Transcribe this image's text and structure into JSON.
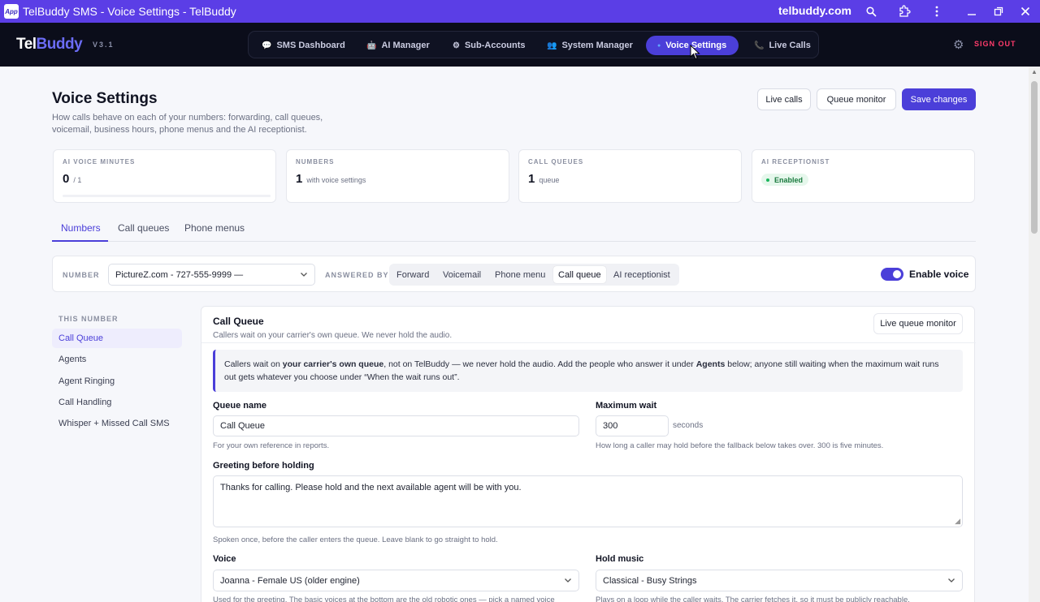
{
  "window": {
    "app_icon": "App",
    "title": "TelBuddy SMS - Voice Settings - TelBuddy",
    "domain": "telbuddy.com",
    "icons": [
      "zoom-icon",
      "extensions-icon",
      "more-icon",
      "minimize-icon",
      "maximize-icon",
      "close-icon"
    ]
  },
  "nav": {
    "brand_tel": "Tel",
    "brand_buddy": "Buddy",
    "version": "V3.1",
    "items": [
      {
        "label": "SMS Dashboard",
        "icon": "💬"
      },
      {
        "label": "AI Manager",
        "icon": "🤖"
      },
      {
        "label": "Sub-Accounts",
        "icon": "⚙"
      },
      {
        "label": "System Manager",
        "icon": "👥"
      },
      {
        "label": "Voice Settings",
        "icon": "●"
      },
      {
        "label": "Live Calls",
        "icon": "📞"
      }
    ],
    "signout": "SIGN OUT"
  },
  "header": {
    "title": "Voice Settings",
    "subtitle": "How calls behave on each of your numbers: forwarding, call queues, voicemail, business hours, phone menus and the AI receptionist.",
    "buttons": {
      "live_calls": "Live calls",
      "queue_monitor": "Queue monitor",
      "save": "Save changes"
    }
  },
  "stats": [
    {
      "label": "AI VOICE MINUTES",
      "value": "0",
      "unit": "/ 1"
    },
    {
      "label": "NUMBERS",
      "value": "1",
      "unit": "with voice settings"
    },
    {
      "label": "CALL QUEUES",
      "value": "1",
      "unit": "queue"
    },
    {
      "label": "AI RECEPTIONIST",
      "badge": "Enabled"
    }
  ],
  "tabs": [
    "Numbers",
    "Call queues",
    "Phone menus"
  ],
  "number_bar": {
    "number_label": "NUMBER",
    "number_value": "PictureZ.com - 727-555-9999 —",
    "answered_label": "ANSWERED BY",
    "modes": [
      "Forward",
      "Voicemail",
      "Phone menu",
      "Call queue",
      "AI receptionist"
    ],
    "active_mode": "Call queue",
    "enable_label": "Enable voice",
    "enable_on": true
  },
  "side": {
    "heading": "THIS NUMBER",
    "items": [
      "Call Queue",
      "Agents",
      "Agent Ringing",
      "Call Handling",
      "Whisper + Missed Call SMS"
    ]
  },
  "panel": {
    "title": "Call Queue",
    "subtitle": "Callers wait on your carrier's own queue. We never hold the audio.",
    "monitor_button": "Live queue monitor",
    "info_parts": {
      "a": "Callers wait on ",
      "b": "your carrier's own queue",
      "c": ", not on TelBuddy — we never hold the audio. Add the people who answer it under ",
      "d": "Agents",
      "e": " below; anyone still waiting when the maximum wait runs out gets whatever you choose under “When the wait runs out”."
    },
    "queue_name_label": "Queue name",
    "queue_name_value": "Call Queue",
    "queue_name_help": "For your own reference in reports.",
    "max_wait_label": "Maximum wait",
    "max_wait_value": "300",
    "max_wait_unit": "seconds",
    "max_wait_help": "How long a caller may hold before the fallback below takes over. 300 is five minutes.",
    "greeting_label": "Greeting before holding",
    "greeting_value": "Thanks for calling. Please hold and the next available agent will be with you.",
    "greeting_help": "Spoken once, before the caller enters the queue. Leave blank to go straight to hold.",
    "voice_label": "Voice",
    "voice_value": "Joanna - Female US (older engine)",
    "voice_help": "Used for the greeting. The basic voices at the bottom are the old robotic ones — pick a named voice",
    "hold_label": "Hold music",
    "hold_value": "Classical - Busy Strings",
    "hold_help": "Plays on a loop while the caller waits. The carrier fetches it, so it must be publicly reachable."
  }
}
